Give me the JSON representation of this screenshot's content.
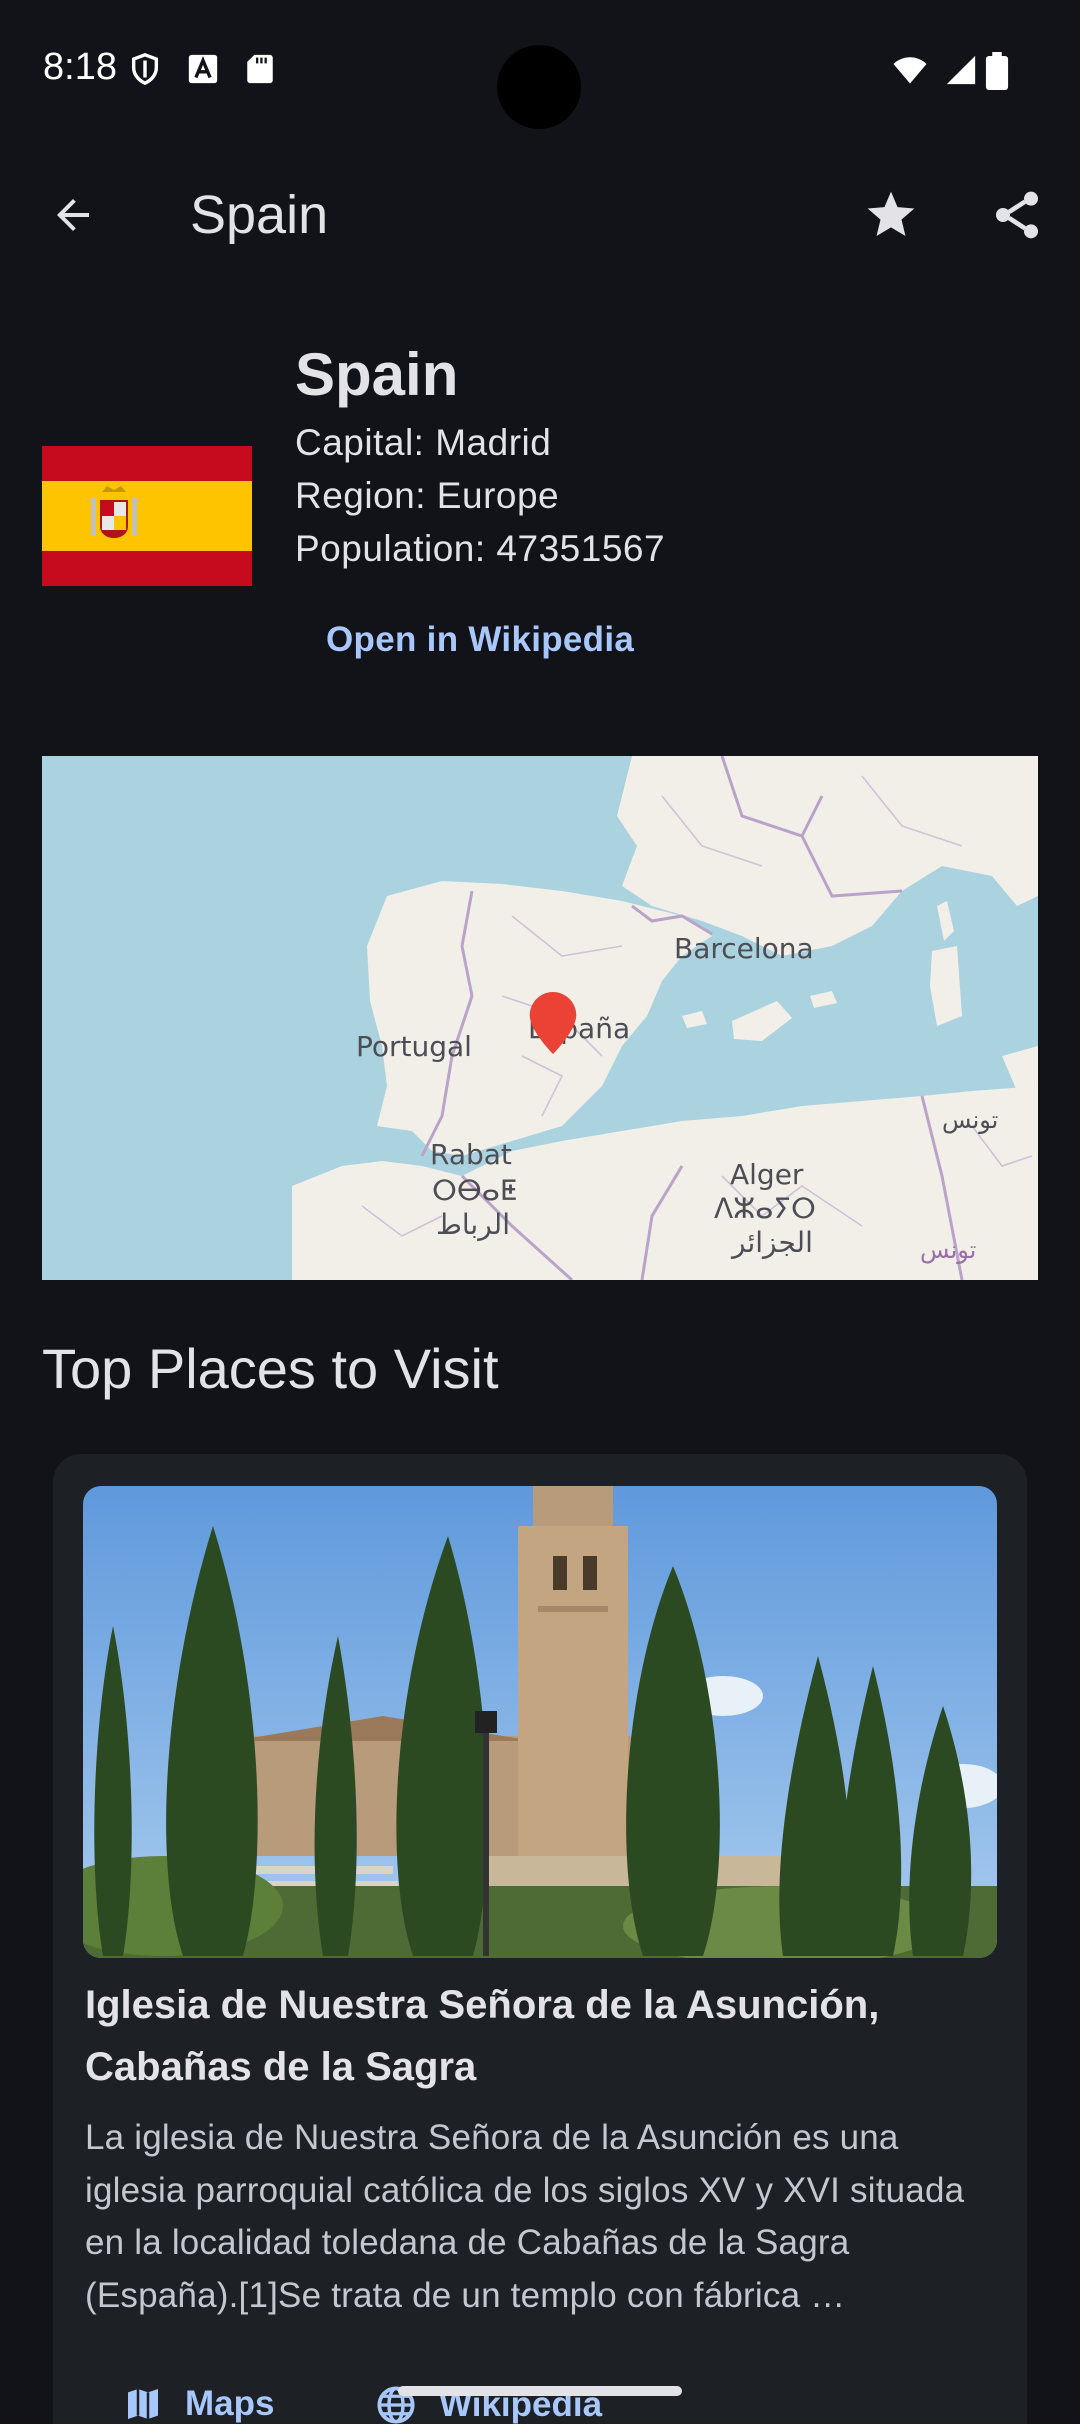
{
  "status_bar": {
    "time": "8:18",
    "left_icons": [
      "shield-icon",
      "font-icon",
      "sd-card-icon"
    ],
    "right_icons": [
      "wifi-icon",
      "signal-icon",
      "battery-icon"
    ]
  },
  "app_bar": {
    "title": "Spain",
    "back_icon": "arrow-back-icon",
    "favorite_icon": "star-icon",
    "share_icon": "share-icon"
  },
  "country": {
    "name": "Spain",
    "capital": "Capital: Madrid",
    "region": "Region: Europe",
    "population": "Population: 47351567",
    "wiki_link": "Open in Wikipedia",
    "flag_colors": {
      "red": "#c60b1e",
      "yellow": "#ffc400"
    }
  },
  "map": {
    "labels": {
      "barcelona": "Barcelona",
      "espana": "España",
      "portugal": "Portugal",
      "rabat": "Rabat",
      "rabat_tifinagh": "ⵔⴱⴰⵟ",
      "rabat_arabic": "الرباط",
      "alger": "Alger",
      "alger_tifinagh": "ⴷⵣⴰⵢⵔ",
      "alger_arabic": "الجزائر",
      "tunis_arabic": "تونس",
      "tunis_arabic_2": "تونس"
    },
    "marker_icon": "map-pin-icon",
    "sea_color": "#aad3df",
    "land_color": "#f2efe9"
  },
  "places": {
    "section_title": "Top Places to Visit",
    "items": [
      {
        "title": "Iglesia de Nuestra Señora de la Asunción, Cabañas de la Sagra",
        "description": "La iglesia de Nuestra Señora de la Asunción es una iglesia parroquial católica de los siglos XV y XVI situada en la localidad toledana de Cabañas de la Sagra (España).[1]Se trata de un templo con fábrica …",
        "actions": [
          {
            "label": "Maps",
            "icon": "map-icon"
          },
          {
            "label": "Wikipedia",
            "icon": "globe-icon"
          }
        ]
      }
    ]
  }
}
